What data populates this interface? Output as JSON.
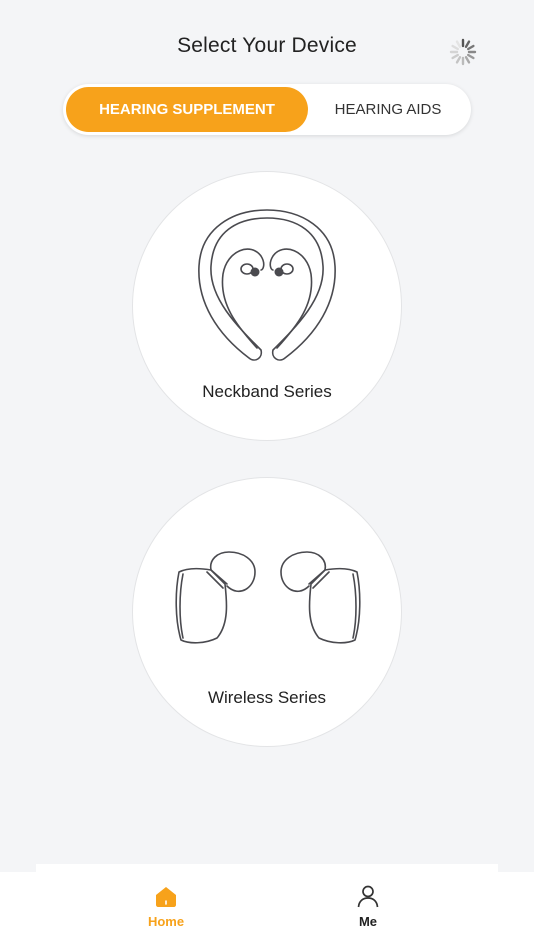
{
  "header": {
    "title": "Select Your Device",
    "loading_icon": "spinner-icon"
  },
  "segment": {
    "options": [
      "HEARING SUPPLEMENT",
      "HEARING AIDS"
    ],
    "selected": "HEARING SUPPLEMENT"
  },
  "devices": [
    {
      "label": "Neckband Series",
      "icon": "neckband-icon"
    },
    {
      "label": "Wireless Series",
      "icon": "earbuds-icon"
    }
  ],
  "tabbar": {
    "items": [
      {
        "label": "Home",
        "icon": "home-icon",
        "active": true
      },
      {
        "label": "Me",
        "icon": "person-icon",
        "active": false
      }
    ]
  },
  "colors": {
    "accent": "#f7a21b",
    "background": "#f4f5f7",
    "card": "#ffffff",
    "outline": "#4a4a4f"
  }
}
